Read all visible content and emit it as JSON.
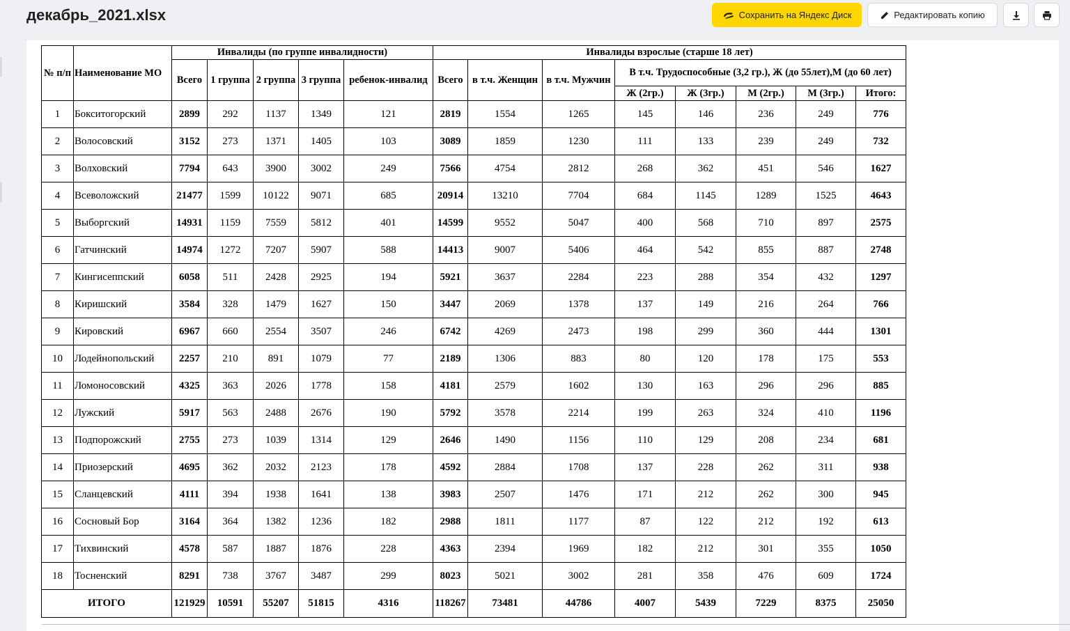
{
  "file": {
    "title": "декабрь_2021.xlsx"
  },
  "toolbar": {
    "save_label": "Сохранить на Яндекс Диск",
    "edit_label": "Редактировать копию",
    "download_icon": "download-icon",
    "print_icon": "print-icon"
  },
  "table": {
    "header": {
      "num": "№ п/п",
      "name": "Наименование МО",
      "group_all": "Инвалиды (по группе инвалидности)",
      "group_adult": "Инвалиды взрослые (старше 18 лет)",
      "total": "Всего",
      "g1": "1 группа",
      "g2": "2 группа",
      "g3": "3 группа",
      "child": "ребенок-инвалид",
      "adult_total": "Всего",
      "women": "в т.ч. Женщин",
      "men": "в т.ч. Мужчин",
      "able": "В т.ч. Трудоспособные (3,2 гр.), Ж (до 55лет),М (до 60 лет)",
      "f2": "Ж (2гр.)",
      "f3": "Ж (3гр.)",
      "m2": "М (2гр.)",
      "m3": "М (3гр.)",
      "itog": "Итого:"
    },
    "rows": [
      [
        "1",
        "Бокситогорский",
        "2899",
        "292",
        "1137",
        "1349",
        "121",
        "2819",
        "1554",
        "1265",
        "145",
        "146",
        "236",
        "249",
        "776"
      ],
      [
        "2",
        "Волосовский",
        "3152",
        "273",
        "1371",
        "1405",
        "103",
        "3089",
        "1859",
        "1230",
        "111",
        "133",
        "239",
        "249",
        "732"
      ],
      [
        "3",
        "Волховский",
        "7794",
        "643",
        "3900",
        "3002",
        "249",
        "7566",
        "4754",
        "2812",
        "268",
        "362",
        "451",
        "546",
        "1627"
      ],
      [
        "4",
        "Всеволожский",
        "21477",
        "1599",
        "10122",
        "9071",
        "685",
        "20914",
        "13210",
        "7704",
        "684",
        "1145",
        "1289",
        "1525",
        "4643"
      ],
      [
        "5",
        "Выборгский",
        "14931",
        "1159",
        "7559",
        "5812",
        "401",
        "14599",
        "9552",
        "5047",
        "400",
        "568",
        "710",
        "897",
        "2575"
      ],
      [
        "6",
        "Гатчинский",
        "14974",
        "1272",
        "7207",
        "5907",
        "588",
        "14413",
        "9007",
        "5406",
        "464",
        "542",
        "855",
        "887",
        "2748"
      ],
      [
        "7",
        "Кингисеппский",
        "6058",
        "511",
        "2428",
        "2925",
        "194",
        "5921",
        "3637",
        "2284",
        "223",
        "288",
        "354",
        "432",
        "1297"
      ],
      [
        "8",
        "Киришский",
        "3584",
        "328",
        "1479",
        "1627",
        "150",
        "3447",
        "2069",
        "1378",
        "137",
        "149",
        "216",
        "264",
        "766"
      ],
      [
        "9",
        "Кировский",
        "6967",
        "660",
        "2554",
        "3507",
        "246",
        "6742",
        "4269",
        "2473",
        "198",
        "299",
        "360",
        "444",
        "1301"
      ],
      [
        "10",
        "Лодейнопольский",
        "2257",
        "210",
        "891",
        "1079",
        "77",
        "2189",
        "1306",
        "883",
        "80",
        "120",
        "178",
        "175",
        "553"
      ],
      [
        "11",
        "Ломоносовский",
        "4325",
        "363",
        "2026",
        "1778",
        "158",
        "4181",
        "2579",
        "1602",
        "130",
        "163",
        "296",
        "296",
        "885"
      ],
      [
        "12",
        "Лужский",
        "5917",
        "563",
        "2488",
        "2676",
        "190",
        "5792",
        "3578",
        "2214",
        "199",
        "263",
        "324",
        "410",
        "1196"
      ],
      [
        "13",
        "Подпорожский",
        "2755",
        "273",
        "1039",
        "1314",
        "129",
        "2646",
        "1490",
        "1156",
        "110",
        "129",
        "208",
        "234",
        "681"
      ],
      [
        "14",
        "Приозерский",
        "4695",
        "362",
        "2032",
        "2123",
        "178",
        "4592",
        "2884",
        "1708",
        "137",
        "228",
        "262",
        "311",
        "938"
      ],
      [
        "15",
        "Сланцевский",
        "4111",
        "394",
        "1938",
        "1641",
        "138",
        "3983",
        "2507",
        "1476",
        "171",
        "212",
        "262",
        "300",
        "945"
      ],
      [
        "16",
        "Сосновый Бор",
        "3164",
        "364",
        "1382",
        "1236",
        "182",
        "2988",
        "1811",
        "1177",
        "87",
        "122",
        "212",
        "192",
        "613"
      ],
      [
        "17",
        "Тихвинский",
        "4578",
        "587",
        "1887",
        "1876",
        "228",
        "4363",
        "2394",
        "1969",
        "182",
        "212",
        "301",
        "355",
        "1050"
      ],
      [
        "18",
        "Тосненский",
        "8291",
        "738",
        "3767",
        "3487",
        "299",
        "8023",
        "5021",
        "3002",
        "281",
        "358",
        "476",
        "609",
        "1724"
      ]
    ],
    "total_row": {
      "label": "ИТОГО",
      "values": [
        "121929",
        "10591",
        "55207",
        "51815",
        "4316",
        "118267",
        "73481",
        "44786",
        "4007",
        "5439",
        "7229",
        "8375",
        "25050"
      ]
    }
  }
}
